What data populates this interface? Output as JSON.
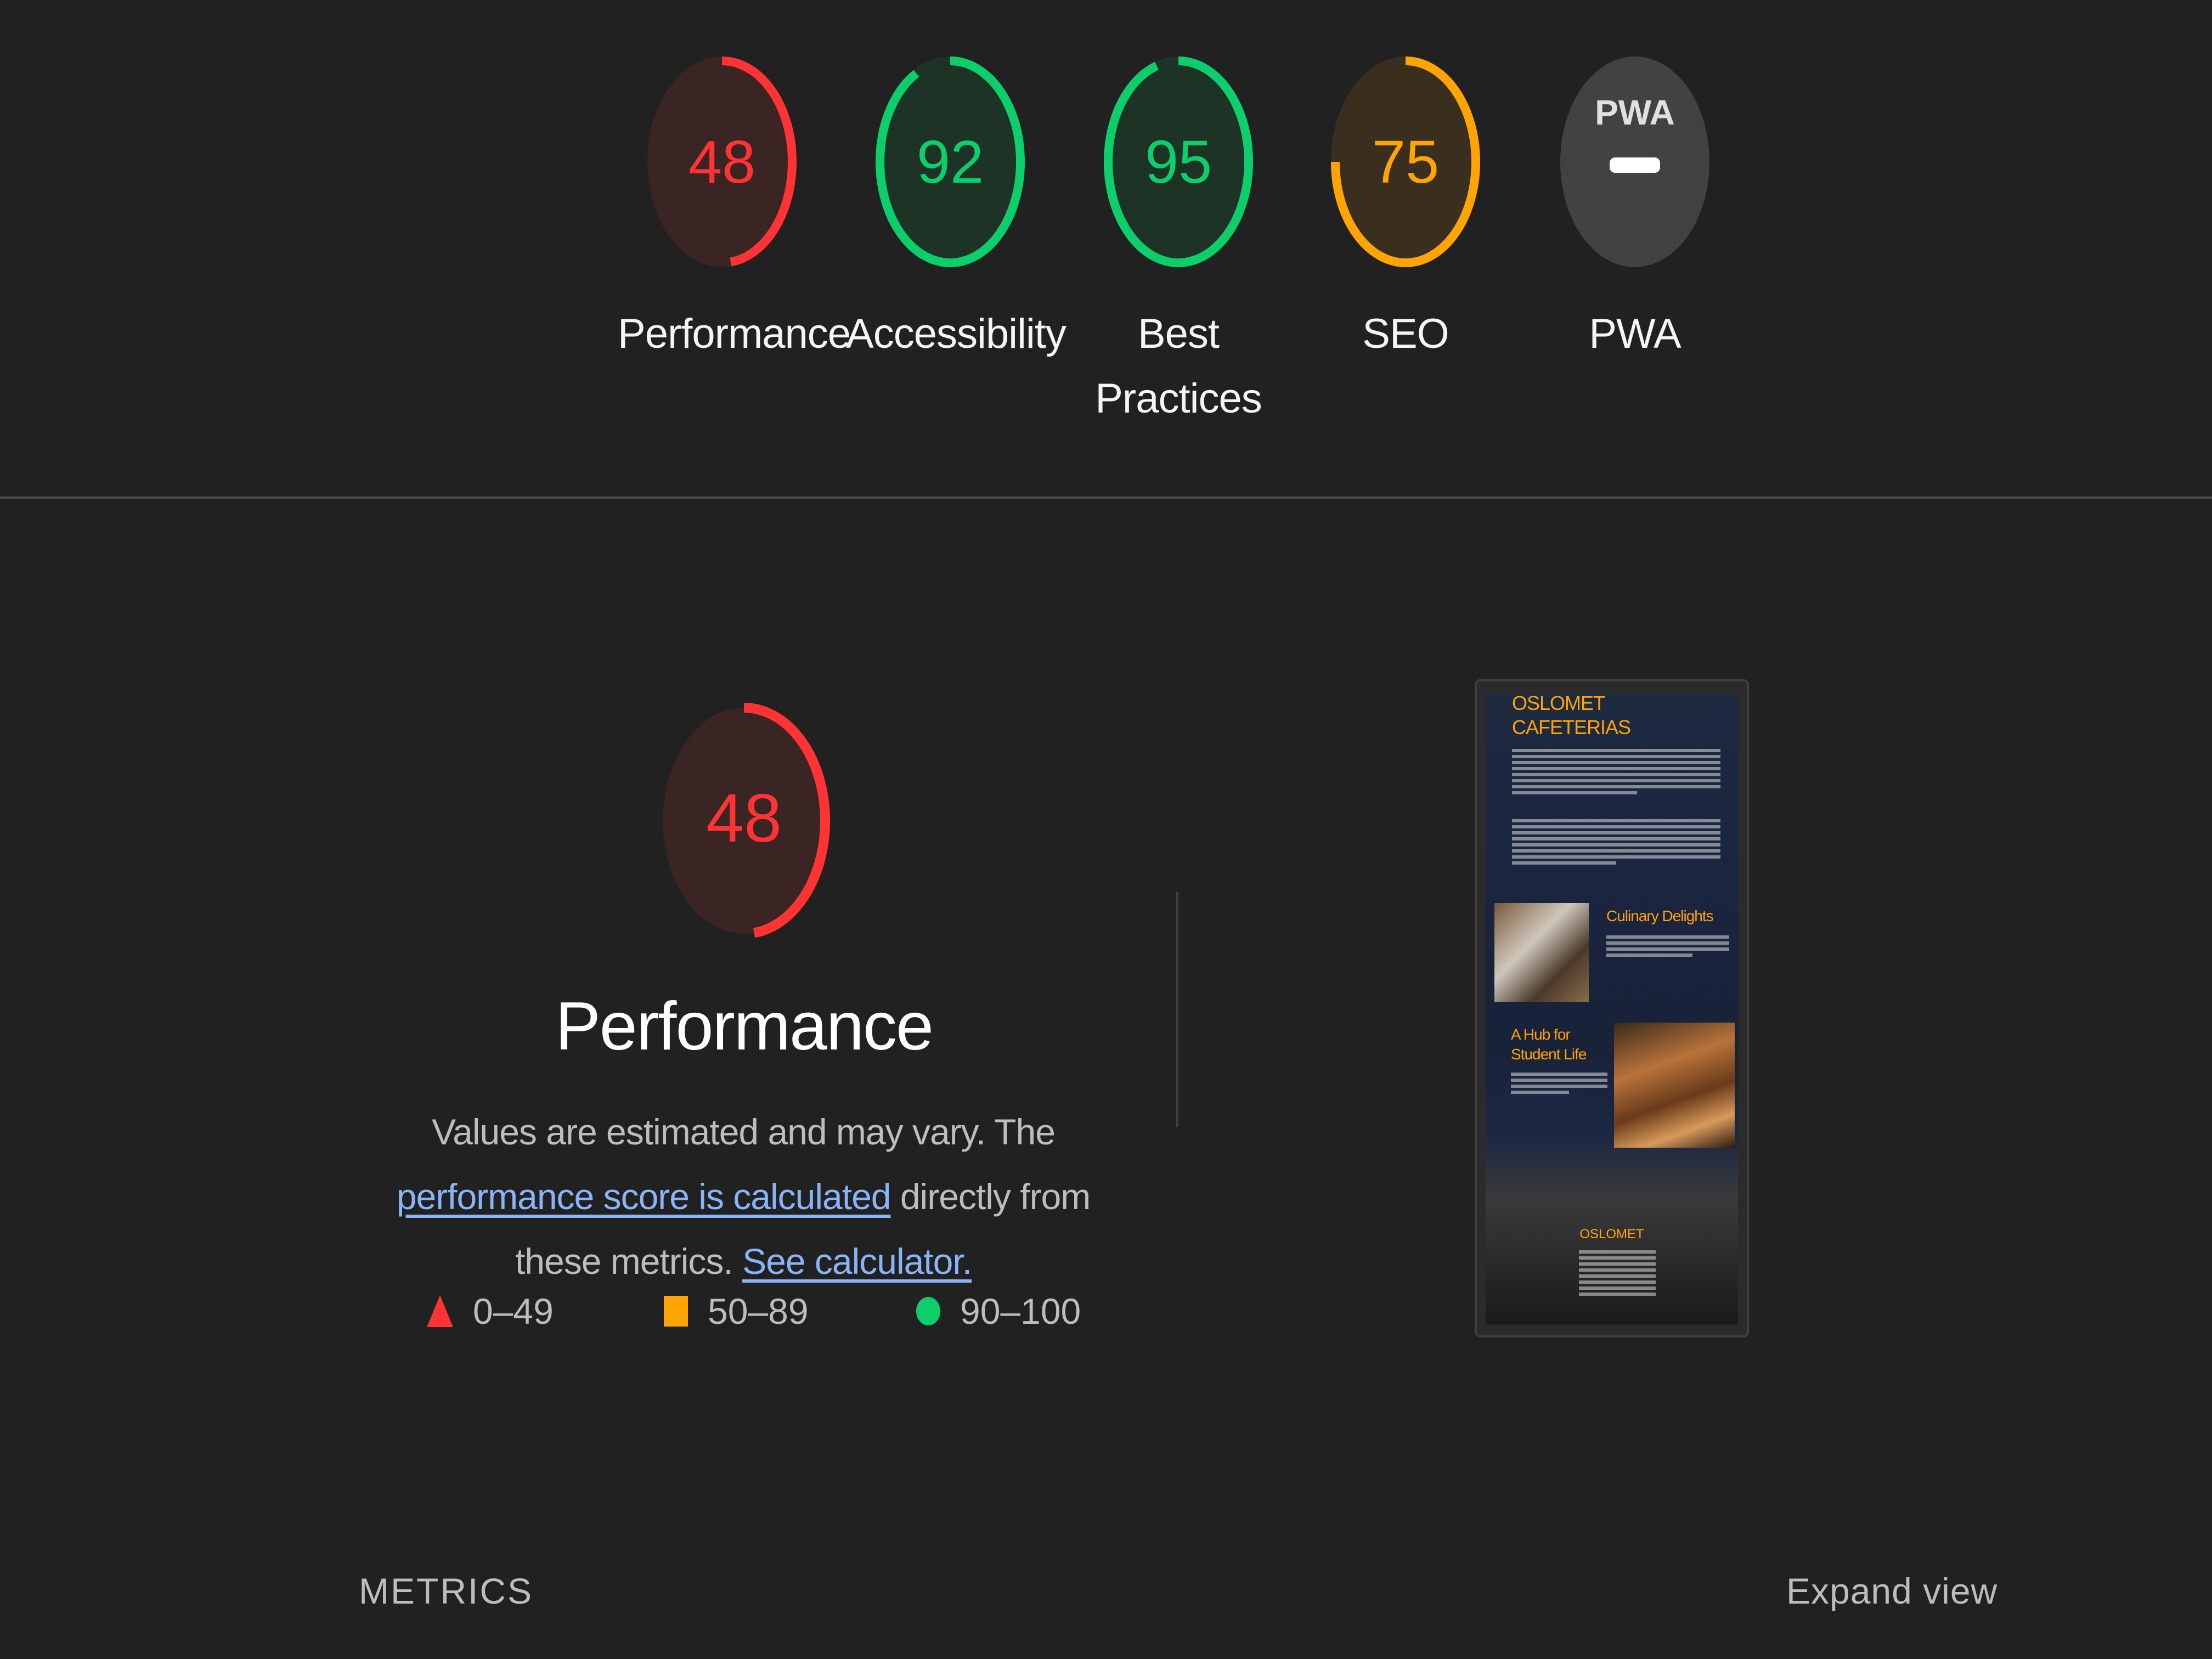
{
  "categories": [
    {
      "label_lines": [
        "Performance"
      ],
      "score": 48,
      "fraction": 0.48,
      "status": "fail"
    },
    {
      "label_lines": [
        "Accessibility"
      ],
      "score": 92,
      "fraction": 0.92,
      "status": "pass"
    },
    {
      "label_lines": [
        "Best",
        "Practices"
      ],
      "score": 95,
      "fraction": 0.95,
      "status": "pass"
    },
    {
      "label_lines": [
        "SEO"
      ],
      "score": 75,
      "fraction": 0.75,
      "status": "average"
    },
    {
      "label_lines": [
        "PWA"
      ],
      "score": null,
      "badge_text": "PWA",
      "status": "na"
    }
  ],
  "colors": {
    "fail": "#ff3333",
    "fail_bg": "#3a2424",
    "average": "#ffa400",
    "average_bg": "#3a2e1f",
    "pass": "#0cce6b",
    "pass_bg": "#1d3326",
    "na_bg": "#424242",
    "link": "#8ab4f8"
  },
  "performance": {
    "score": 48,
    "fraction": 0.48,
    "title": "Performance",
    "desc_prefix": "Values are estimated and may vary. The ",
    "desc_link1": "performance score is calculated",
    "desc_middle": " directly from these metrics. ",
    "desc_link2": "See calculator."
  },
  "legend": [
    {
      "shape": "triangle",
      "range": "0–49"
    },
    {
      "shape": "square",
      "range": "50–89"
    },
    {
      "shape": "circle",
      "range": "90–100"
    }
  ],
  "screenshot": {
    "title_lines": [
      "OSLOMET",
      "CAFETERIAS"
    ],
    "section1": "Culinary Delights",
    "section2_lines": [
      "A Hub for",
      "Student Life"
    ],
    "footer": "OSLOMET"
  },
  "metrics_label": "METRICS",
  "expand_label": "Expand view"
}
